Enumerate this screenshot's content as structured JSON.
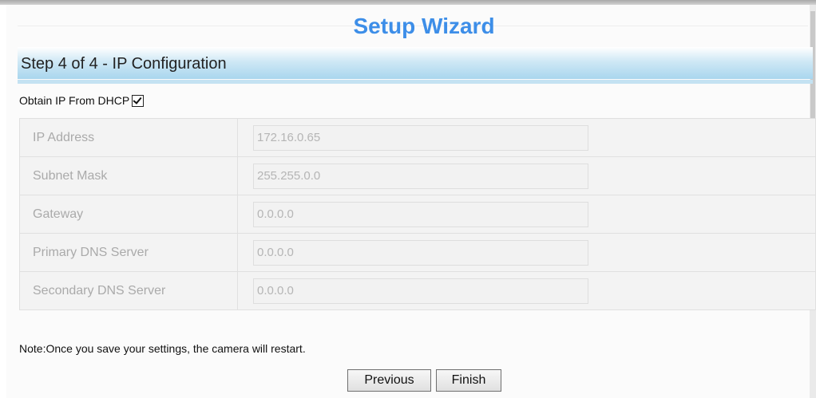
{
  "wizard": {
    "title": "Setup Wizard",
    "step_title": "Step 4 of 4 - IP Configuration"
  },
  "dhcp": {
    "label": "Obtain IP From DHCP",
    "checked": true
  },
  "fields": [
    {
      "label": "IP Address",
      "value": "172.16.0.65"
    },
    {
      "label": "Subnet Mask",
      "value": "255.255.0.0"
    },
    {
      "label": "Gateway",
      "value": "0.0.0.0"
    },
    {
      "label": "Primary DNS Server",
      "value": "0.0.0.0"
    },
    {
      "label": "Secondary DNS Server",
      "value": "0.0.0.0"
    }
  ],
  "note": "Note:Once you save your settings, the camera will restart.",
  "buttons": {
    "previous": "Previous",
    "finish": "Finish"
  },
  "colors": {
    "title": "#3d8ee8",
    "step_bar": "#a9d6ee"
  }
}
